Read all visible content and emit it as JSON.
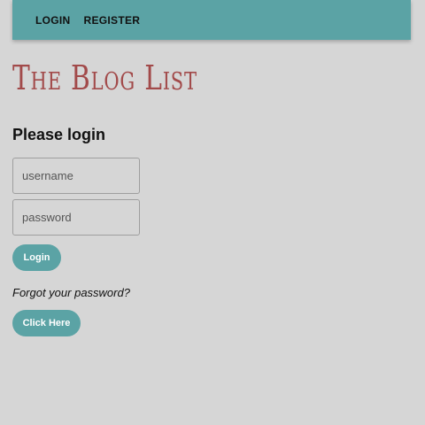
{
  "nav": {
    "login_label": "LOGIN",
    "register_label": "REGISTER"
  },
  "site": {
    "title": "The Blog List"
  },
  "login_form": {
    "heading": "Please login",
    "username_placeholder": "username",
    "password_placeholder": "password",
    "submit_label": "Login"
  },
  "forgot": {
    "text": "Forgot your password?",
    "button_label": "Click Here"
  },
  "colors": {
    "accent": "#5ba3a5",
    "title": "#a24a4a",
    "background": "#d6d6d6"
  }
}
